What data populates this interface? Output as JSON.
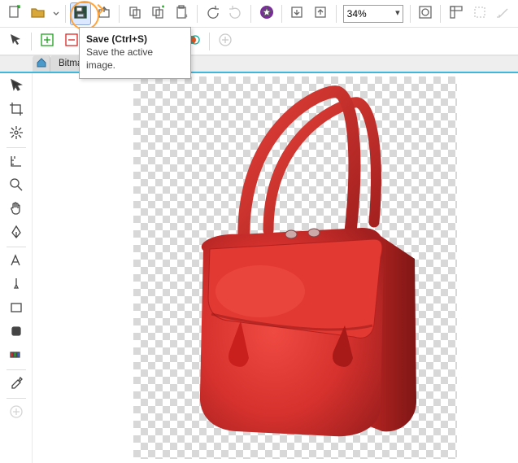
{
  "toolbar1": {
    "new": {
      "icon": "new-document-icon"
    },
    "open": {
      "icon": "open-folder-icon"
    },
    "save": {
      "icon": "save-icon",
      "pressed": true
    },
    "export": {
      "icon": "export-icon"
    },
    "copy": {
      "icon": "copy-icon"
    },
    "copy_new": {
      "icon": "copy-new-icon"
    },
    "paste_new": {
      "icon": "paste-new-icon"
    },
    "undo": {
      "icon": "undo-icon"
    },
    "redo": {
      "icon": "redo-icon"
    },
    "star": {
      "icon": "star-circle-icon"
    },
    "import": {
      "icon": "import-to-canvas-icon"
    },
    "send": {
      "icon": "export-from-canvas-icon"
    },
    "zoom_value": "34%",
    "view_mask": {
      "icon": "view-mask-icon"
    },
    "rulers": {
      "icon": "rulers-icon"
    },
    "snap": {
      "icon": "snap-grid-icon"
    },
    "snap2": {
      "icon": "snap-guides-icon"
    }
  },
  "tooltip": {
    "title": "Save (Ctrl+S)",
    "body": "Save the active image."
  },
  "toolbar2": {
    "pointer": {
      "icon": "pointer-icon"
    },
    "new_layer": {
      "icon": "new-layer-icon"
    },
    "delete_layer": {
      "icon": "delete-layer-icon"
    },
    "mask": {
      "icon": "mask-icon"
    },
    "layer_up": {
      "icon": "layer-up-icon"
    },
    "layer_down": {
      "icon": "layer-down-icon"
    },
    "feather": {
      "icon": "feather-icon"
    },
    "overlay_solid": {
      "icon": "overlay-solid-icon"
    },
    "overlay_dashed": {
      "icon": "overlay-dashed-icon"
    },
    "overlay_depth": {
      "icon": "overlay-depth-icon"
    },
    "add_node": {
      "icon": "add-node-icon"
    }
  },
  "tabs": {
    "home": {
      "icon": "home-icon"
    },
    "document": {
      "label": "Bitmap*"
    },
    "add": {
      "icon": "add-tab-icon"
    }
  },
  "sidetools": [
    {
      "id": "arrow",
      "icon": "arrow-tool-icon"
    },
    {
      "id": "crop",
      "icon": "crop-tool-icon"
    },
    {
      "id": "heal",
      "icon": "heal-tool-icon"
    },
    {
      "id": "sep"
    },
    {
      "id": "straighten",
      "icon": "straighten-tool-icon"
    },
    {
      "id": "zoom",
      "icon": "zoom-tool-icon"
    },
    {
      "id": "pan",
      "icon": "pan-tool-icon"
    },
    {
      "id": "pen",
      "icon": "pen-tool-icon"
    },
    {
      "id": "sep"
    },
    {
      "id": "text",
      "icon": "text-tool-icon"
    },
    {
      "id": "brush",
      "icon": "brush-tool-icon"
    },
    {
      "id": "rect",
      "icon": "rect-tool-icon"
    },
    {
      "id": "erase",
      "icon": "eraser-tool-icon"
    },
    {
      "id": "color",
      "icon": "color-sample-icon"
    },
    {
      "id": "sep"
    },
    {
      "id": "dropper",
      "icon": "eyedropper-tool-icon"
    },
    {
      "id": "sep"
    },
    {
      "id": "addtool",
      "icon": "add-tool-icon"
    }
  ],
  "canvas": {
    "subject": "red-leather-handbag"
  }
}
